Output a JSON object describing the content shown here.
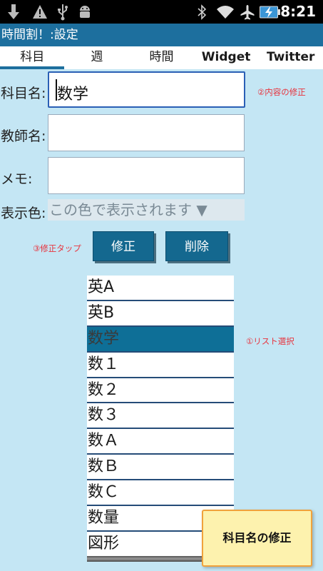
{
  "status_bar": {
    "time": "8:21",
    "icons": [
      "download-icon",
      "warning-icon",
      "usb-icon",
      "android-debug-icon",
      "bluetooth-icon",
      "wifi-icon",
      "airplane-mode-icon",
      "battery-charging-icon"
    ]
  },
  "app": {
    "title": "時間割！:設定"
  },
  "tabs": [
    {
      "label": "科目",
      "selected": true
    },
    {
      "label": "週"
    },
    {
      "label": "時間"
    },
    {
      "label": "Widget"
    },
    {
      "label": "Twitter"
    }
  ],
  "form": {
    "subject_label": "科目名:",
    "subject_value": "数学",
    "teacher_label": "教師名:",
    "teacher_value": "",
    "memo_label": "メモ:",
    "memo_value": "",
    "color_label": "表示色:",
    "color_select": "この色で表示されます ▼"
  },
  "annotations": {
    "edit_content": "②内容の修正",
    "tap_edit": "③修正タップ",
    "select_list": "①リスト選択"
  },
  "buttons": {
    "edit": "修正",
    "delete": "削除"
  },
  "subject_list": {
    "selected_index": 2,
    "items": [
      "英A",
      "英B",
      "数学",
      "数１",
      "数２",
      "数３",
      "数Ａ",
      "数Ｂ",
      "数Ｃ",
      "数量",
      "図形"
    ]
  },
  "note": "科目名の修正",
  "colors": {
    "background": "#c4e6f4",
    "title_bar": "#1d6f9e",
    "button": "#14688f",
    "selected_row": "#0e6f97",
    "annotation": "#e8323c",
    "note_background": "#fdf2ae",
    "note_border": "#f0a23c"
  }
}
